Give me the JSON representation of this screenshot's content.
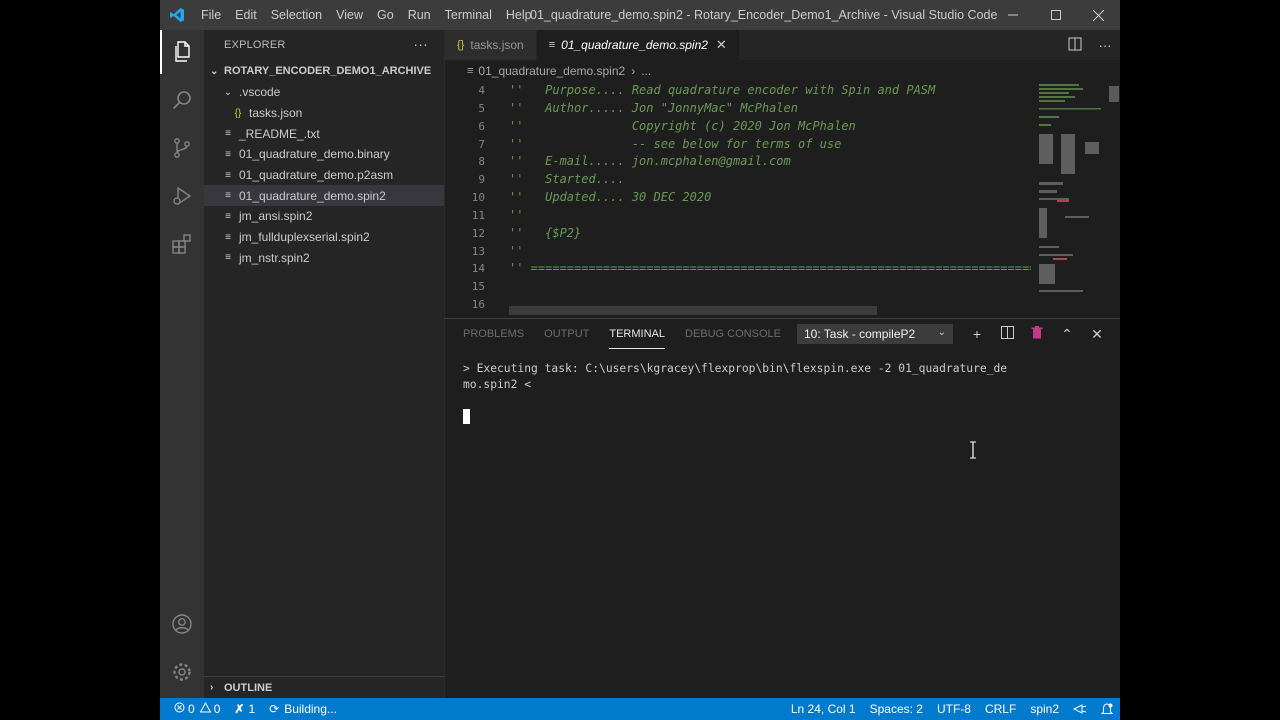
{
  "titlebar": {
    "menu": [
      "File",
      "Edit",
      "Selection",
      "View",
      "Go",
      "Run",
      "Terminal",
      "Help"
    ],
    "title": "01_quadrature_demo.spin2 - Rotary_Encoder_Demo1_Archive - Visual Studio Code",
    "logo_color": "#23a9f2"
  },
  "activitybar": {
    "icons": [
      "files-icon",
      "search-icon",
      "source-control-icon",
      "run-debug-icon",
      "extensions-icon",
      "account-icon",
      "settings-gear-icon"
    ]
  },
  "sidebar": {
    "header": "EXPLORER",
    "section": "ROTARY_ENCODER_DEMO1_ARCHIVE",
    "items": [
      {
        "label": ".vscode",
        "kind": "folder",
        "level": 1
      },
      {
        "label": "tasks.json",
        "kind": "json",
        "level": 2
      },
      {
        "label": "_README_.txt",
        "kind": "file",
        "level": 1
      },
      {
        "label": "01_quadrature_demo.binary",
        "kind": "file",
        "level": 1
      },
      {
        "label": "01_quadrature_demo.p2asm",
        "kind": "file",
        "level": 1
      },
      {
        "label": "01_quadrature_demo.spin2",
        "kind": "file",
        "level": 1,
        "selected": true
      },
      {
        "label": "jm_ansi.spin2",
        "kind": "file",
        "level": 1
      },
      {
        "label": "jm_fullduplexserial.spin2",
        "kind": "file",
        "level": 1
      },
      {
        "label": "jm_nstr.spin2",
        "kind": "file",
        "level": 1
      }
    ],
    "outline": "OUTLINE"
  },
  "editor": {
    "tabs": [
      {
        "label": "tasks.json",
        "active": false
      },
      {
        "label": "01_quadrature_demo.spin2",
        "active": true
      }
    ],
    "breadcrumb": [
      "01_quadrature_demo.spin2",
      "..."
    ],
    "lines": [
      {
        "n": "4",
        "text": "''   Purpose.... Read quadrature encoder with Spin and PASM"
      },
      {
        "n": "5",
        "text": "''   Author..... Jon \"JonnyMac\" McPhalen"
      },
      {
        "n": "6",
        "text": "''               Copyright (c) 2020 Jon McPhalen"
      },
      {
        "n": "7",
        "text": "''               -- see below for terms of use"
      },
      {
        "n": "8",
        "text": "''   E-mail..... jon.mcphalen@gmail.com"
      },
      {
        "n": "9",
        "text": "''   Started...."
      },
      {
        "n": "10",
        "text": "''   Updated.... 30 DEC 2020"
      },
      {
        "n": "11",
        "text": "''"
      },
      {
        "n": "12",
        "text": "''   {$P2}"
      },
      {
        "n": "13",
        "text": "''"
      },
      {
        "n": "14",
        "text": "'' ==========================================================================="
      },
      {
        "n": "15",
        "text": ""
      },
      {
        "n": "16",
        "text": ""
      }
    ]
  },
  "panel": {
    "tabs": [
      "PROBLEMS",
      "OUTPUT",
      "TERMINAL",
      "DEBUG CONSOLE"
    ],
    "active_tab": "TERMINAL",
    "task_select": "10: Task - compileP2",
    "terminal_line1": "> Executing task: C:\\users\\kgracey\\flexprop\\bin\\flexspin.exe -2 01_quadrature_de",
    "terminal_line2": "mo.spin2 <"
  },
  "statusbar": {
    "errors": "0",
    "warnings": "0",
    "tools": "1",
    "building": "Building...",
    "position": "Ln 24, Col 1",
    "spaces": "Spaces: 2",
    "encoding": "UTF-8",
    "eol": "CRLF",
    "language": "spin2",
    "color": "#007acc"
  }
}
